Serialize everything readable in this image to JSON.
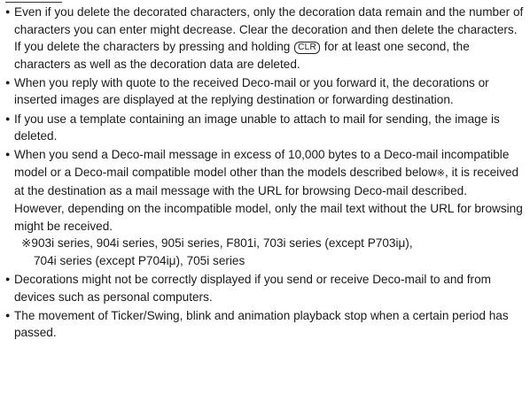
{
  "notes": [
    {
      "before_key": "Even if you delete the decorated characters, only the decoration data remain and the number of characters you can enter might decrease. Clear the decoration and then delete the characters. If you delete the characters by pressing and holding ",
      "key_label": "CLR",
      "after_key": " for at least one second, the characters as well as the decoration data are deleted."
    },
    {
      "text": "When you reply with quote to the received Deco-mail or you forward it, the decorations or inserted images are displayed at the replying destination or forwarding destination."
    },
    {
      "text": "If you use a template containing an image unable to attach to mail for sending, the image is deleted."
    },
    {
      "text_before_mark": "When you send a Deco-mail message in excess of 10,000 bytes to a Deco-mail incompatible model or a Deco-mail compatible model other than the models described below",
      "mark": "※",
      "text_after_mark": ", it is received at the destination as a mail message with the URL for browsing Deco-mail described.",
      "continuation": "However, depending on the incompatible model, only the mail text without the URL for browsing might be received.",
      "models_line1": "※903i series, 904i series, 905i series, F801i, 703i series (except P703iμ),",
      "models_line2": "704i series (except P704iμ), 705i series"
    },
    {
      "text": "Decorations might not be correctly displayed if you send or receive Deco-mail to and from devices such as personal computers."
    },
    {
      "text": "The movement of Ticker/Swing, blink and animation playback stop when a certain period has passed."
    }
  ],
  "bullet": "●"
}
